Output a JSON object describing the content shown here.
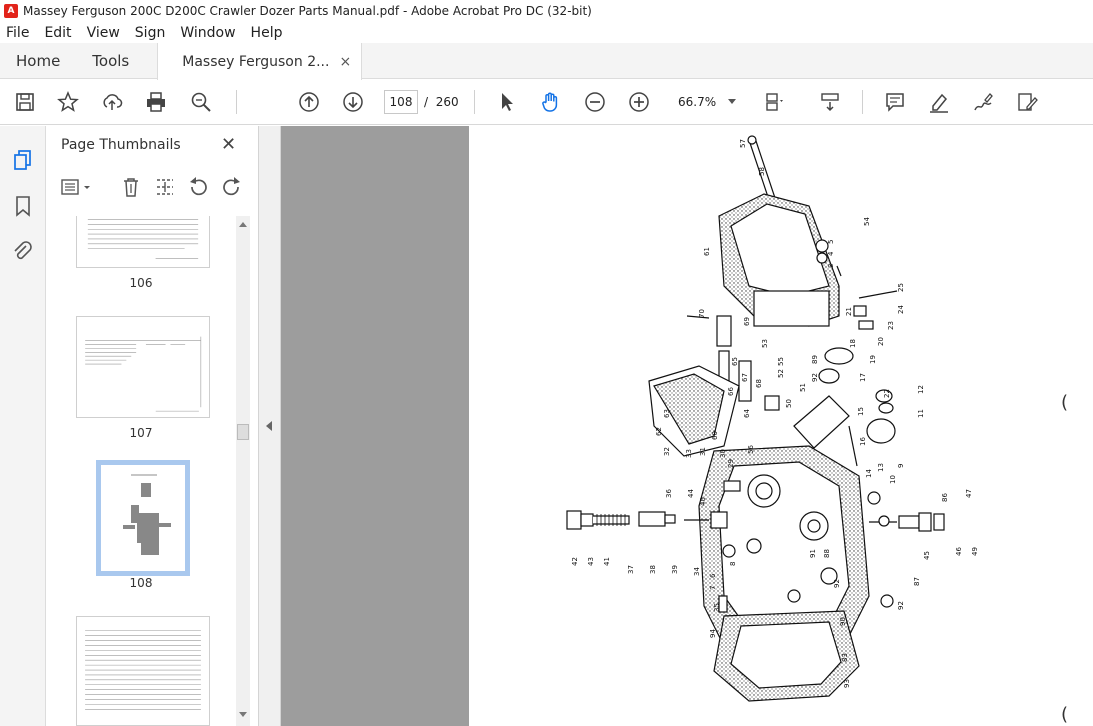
{
  "window": {
    "title": "Massey Ferguson 200C D200C Crawler Dozer Parts Manual.pdf - Adobe Acrobat Pro DC (32-bit)",
    "app_icon": "acrobat-icon"
  },
  "menu": {
    "items": [
      "File",
      "Edit",
      "View",
      "Sign",
      "Window",
      "Help"
    ]
  },
  "tabs": {
    "home": "Home",
    "tools": "Tools",
    "doc_tab": "Massey Ferguson 2...",
    "close": "×"
  },
  "toolbar": {
    "icons": [
      "save-icon",
      "star-icon",
      "upload-icon",
      "print-icon",
      "search-zoom-icon",
      "page-up-icon",
      "page-down-icon",
      "select-cursor-icon",
      "hand-icon",
      "zoom-out-icon",
      "zoom-in-icon",
      "fit-page-icon",
      "scroll-mode-icon",
      "comment-icon",
      "highlight-icon",
      "sign-icon",
      "edit-icon"
    ],
    "current_page": "108",
    "page_separator": "/",
    "total_pages": "260",
    "zoom": "66.7%"
  },
  "panel": {
    "title": "Page Thumbnails",
    "close": "✕",
    "thumbnails": [
      {
        "label": "106",
        "selected": false
      },
      {
        "label": "107",
        "selected": false
      },
      {
        "label": "108",
        "selected": true
      },
      {
        "label": "",
        "selected": false
      }
    ]
  },
  "colors": {
    "accent": "#1473e6",
    "selection": "#a9c8ee",
    "canvas": "#9d9d9d"
  },
  "diagram_labels": [
    "57",
    "58",
    "54",
    "61",
    "5",
    "4",
    "3",
    "25",
    "24",
    "23",
    "70",
    "69",
    "53",
    "21",
    "20",
    "18",
    "19",
    "17",
    "55",
    "52",
    "65",
    "66",
    "67",
    "68",
    "89",
    "92",
    "12",
    "11",
    "22",
    "15",
    "16",
    "9",
    "64",
    "63",
    "62",
    "60",
    "56",
    "51",
    "50",
    "33",
    "32",
    "31",
    "30",
    "29",
    "13",
    "14",
    "10",
    "86",
    "47",
    "36",
    "44",
    "40",
    "42",
    "43",
    "41",
    "37",
    "38",
    "39",
    "34",
    "6",
    "7",
    "8",
    "45",
    "46",
    "48",
    "49",
    "87",
    "35",
    "94",
    "91",
    "93",
    "83",
    "90",
    "88"
  ]
}
